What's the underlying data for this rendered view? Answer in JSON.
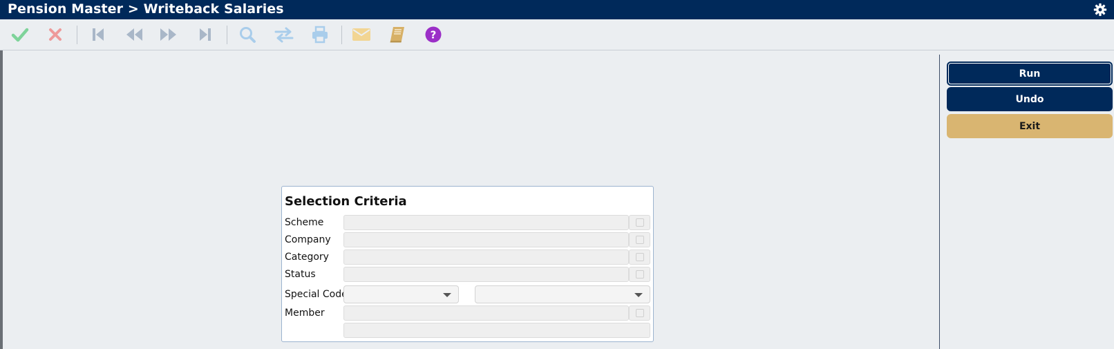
{
  "window": {
    "title": "Pension Master > Writeback Salaries"
  },
  "icons": {
    "settings": "gear-icon",
    "toolbar": [
      "check-icon",
      "close-icon",
      "first-record-icon",
      "previous-record-icon",
      "next-record-icon",
      "last-record-icon",
      "search-icon",
      "swap-icon",
      "print-icon",
      "mail-icon",
      "notebook-icon",
      "help-icon"
    ]
  },
  "colors": {
    "title_bg": "#00295a",
    "primary_button": "#00295a",
    "exit_button": "#d9b571",
    "accept_icon": "#5cc47a",
    "cancel_icon": "#e87b7b",
    "help_icon": "#9b2fc7"
  },
  "actions": {
    "run_label": "Run",
    "undo_label": "Undo",
    "exit_label": "Exit"
  },
  "criteria": {
    "title": "Selection Criteria",
    "scheme_label": "Scheme",
    "company_label": "Company",
    "category_label": "Category",
    "status_label": "Status",
    "special_code_label": "Special Code",
    "member_label": "Member",
    "scheme_value": "",
    "company_value": "",
    "category_value": "",
    "status_value": "",
    "special_code_value_1": "",
    "special_code_value_2": "",
    "member_value": "",
    "member_name_value": ""
  }
}
